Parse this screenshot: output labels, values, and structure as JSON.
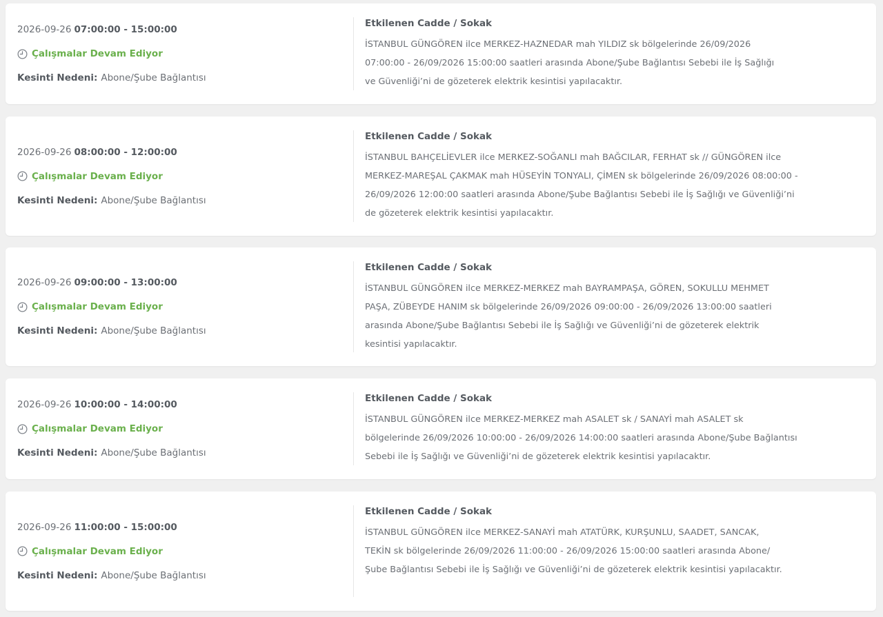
{
  "cards": [
    {
      "date": "2026-09-26",
      "time": "07:00:00 - 15:00:00",
      "status": "Çalışmalar Devam Ediyor",
      "reason_label": "Kesinti Nedeni:",
      "reason": "Abone/Şube Bağlantısı",
      "title": "Etkilenen Cadde / Sokak",
      "description": "İSTANBUL GÜNGÖREN ilce MERKEZ-HAZNEDAR mah YILDIZ sk bölgelerinde 26/09/2026 07:00:00 - 26/09/2026 15:00:00 saatleri arasında Abone/Şube Bağlantısı Sebebi ile İş Sağlığı ve Güvenliği’ni de gözeterek elektrik kesintisi yapılacaktır."
    },
    {
      "date": "2026-09-26",
      "time": "08:00:00 - 12:00:00",
      "status": "Çalışmalar Devam Ediyor",
      "reason_label": "Kesinti Nedeni:",
      "reason": "Abone/Şube Bağlantısı",
      "title": "Etkilenen Cadde / Sokak",
      "description": "İSTANBUL BAHÇELİEVLER ilce MERKEZ-SOĞANLI mah BAĞCILAR, FERHAT sk // GÜNGÖREN ilce MERKEZ-MAREŞAL ÇAKMAK mah HÜSEYİN TONYALI, ÇİMEN sk bölgelerinde 26/09/2026 08:00:00 - 26/09/2026 12:00:00 saatleri arasında Abone/Şube Bağlantısı Sebebi ile İş Sağlığı ve Güvenliği’ni de gözeterek elektrik kesintisi yapılacaktır."
    },
    {
      "date": "2026-09-26",
      "time": "09:00:00 - 13:00:00",
      "status": "Çalışmalar Devam Ediyor",
      "reason_label": "Kesinti Nedeni:",
      "reason": "Abone/Şube Bağlantısı",
      "title": "Etkilenen Cadde / Sokak",
      "description": "İSTANBUL GÜNGÖREN ilce MERKEZ-MERKEZ mah BAYRAMPAŞA, GÖREN, SOKULLU MEHMET PAŞA, ZÜBEYDE HANIM sk bölgelerinde 26/09/2026 09:00:00 - 26/09/2026 13:00:00 saatleri arasında Abone/Şube Bağlantısı Sebebi ile İş Sağlığı ve Güvenliği’ni de gözeterek elektrik kesintisi yapılacaktır."
    },
    {
      "date": "2026-09-26",
      "time": "10:00:00 - 14:00:00",
      "status": "Çalışmalar Devam Ediyor",
      "reason_label": "Kesinti Nedeni:",
      "reason": "Abone/Şube Bağlantısı",
      "title": "Etkilenen Cadde / Sokak",
      "description": "İSTANBUL GÜNGÖREN ilce MERKEZ-MERKEZ mah ASALET sk / SANAYİ mah ASALET sk bölgelerinde 26/09/2026 10:00:00 - 26/09/2026 14:00:00 saatleri arasında Abone/Şube Bağlantısı Sebebi ile İş Sağlığı ve Güvenliği’ni de gözeterek elektrik kesintisi yapılacaktır."
    },
    {
      "date": "2026-09-26",
      "time": "11:00:00 - 15:00:00",
      "status": "Çalışmalar Devam Ediyor",
      "reason_label": "Kesinti Nedeni:",
      "reason": "Abone/Şube Bağlantısı",
      "title": "Etkilenen Cadde / Sokak",
      "description": "İSTANBUL GÜNGÖREN ilce MERKEZ-SANAYİ mah ATATÜRK, KURŞUNLU, SAADET, SANCAK, TEKİN sk bölgelerinde 26/09/2026 11:00:00 - 26/09/2026 15:00:00 saatleri arasında Abone/ Şube Bağlantısı Sebebi ile İş Sağlığı ve Güvenliği’ni de gözeterek elektrik kesintisi yapılacaktır."
    }
  ],
  "icons": {
    "status": "clock-icon"
  },
  "colors": {
    "status_green": "#6ab04c",
    "text": "#6b6f75",
    "heading": "#555a60",
    "background": "#f0f0f0",
    "card": "#ffffff"
  }
}
